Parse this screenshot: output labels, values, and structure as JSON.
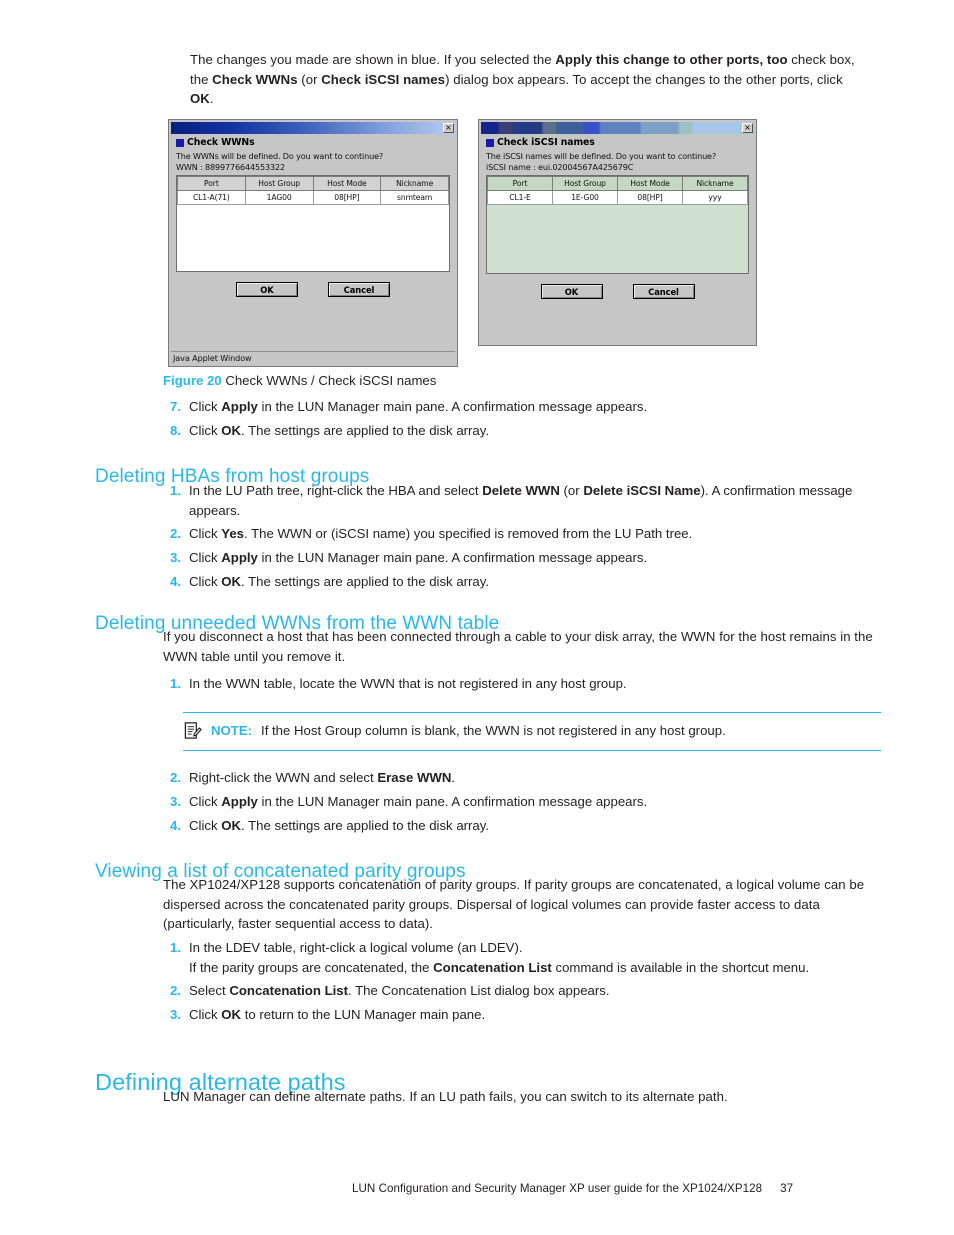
{
  "intro": {
    "line_parts": [
      {
        "t": "The changes you made are shown in blue. If you selected the ",
        "b": false
      },
      {
        "t": "Apply this change to other ports, too",
        "b": true
      },
      {
        "t": " check box, the ",
        "b": false
      },
      {
        "t": "Check WWNs",
        "b": true
      },
      {
        "t": " (or ",
        "b": false
      },
      {
        "t": "Check iSCSI names",
        "b": true
      },
      {
        "t": ") dialog box appears. To accept the changes to the other ports, click ",
        "b": false
      },
      {
        "t": "OK",
        "b": true
      },
      {
        "t": ".",
        "b": false
      }
    ]
  },
  "dialog_wwn": {
    "title": "Check WWNs",
    "close_label": "×",
    "message_line1": "The WWNs will be defined. Do you want to continue?",
    "message_line2": "WWN : 8899776644553322",
    "columns": [
      "Port",
      "Host Group",
      "Host Mode",
      "Nickname"
    ],
    "rows": [
      [
        "CL1-A(71)",
        "1AG00",
        "08[HP]",
        "snmteam"
      ]
    ],
    "ok_label": "OK",
    "cancel_label": "Cancel",
    "status_bar": "Java Applet Window"
  },
  "dialog_iscsi": {
    "title": "Check iSCSI names",
    "close_label": "×",
    "message_line1": "The iSCSI names will be defined. Do you want to continue?",
    "message_line2": "iSCSI name : eui.02004567A425679C",
    "columns": [
      "Port",
      "Host Group",
      "Host Mode",
      "Nickname"
    ],
    "rows": [
      [
        "CL1-E",
        "1E-G00",
        "08[HP]",
        "yyy"
      ]
    ],
    "ok_label": "OK",
    "cancel_label": "Cancel"
  },
  "figure": {
    "label": "Figure 20",
    "caption": "Check WWNs / Check iSCSI names"
  },
  "steps_top": [
    {
      "num": "7.",
      "parts": [
        {
          "t": "Click ",
          "b": false
        },
        {
          "t": "Apply",
          "b": true
        },
        {
          "t": " in the LUN Manager main pane. A confirmation message appears.",
          "b": false
        }
      ]
    },
    {
      "num": "8.",
      "parts": [
        {
          "t": "Click ",
          "b": false
        },
        {
          "t": "OK",
          "b": true
        },
        {
          "t": ". The settings are applied to the disk array.",
          "b": false
        }
      ]
    }
  ],
  "section_hbas": {
    "heading": "Deleting HBAs from host groups",
    "steps": [
      {
        "num": "1.",
        "parts": [
          {
            "t": "In the LU Path tree, right-click the HBA and select ",
            "b": false
          },
          {
            "t": "Delete WWN",
            "b": true
          },
          {
            "t": " (or ",
            "b": false
          },
          {
            "t": "Delete iSCSI Name",
            "b": true
          },
          {
            "t": "). A confirmation message appears.",
            "b": false
          }
        ]
      },
      {
        "num": "2.",
        "parts": [
          {
            "t": "Click ",
            "b": false
          },
          {
            "t": "Yes",
            "b": true
          },
          {
            "t": ". The WWN or (iSCSI name) you specified is removed from the LU Path tree.",
            "b": false
          }
        ]
      },
      {
        "num": "3.",
        "parts": [
          {
            "t": "Click ",
            "b": false
          },
          {
            "t": "Apply",
            "b": true
          },
          {
            "t": " in the LUN Manager main pane. A confirmation message appears.",
            "b": false
          }
        ]
      },
      {
        "num": "4.",
        "parts": [
          {
            "t": "Click ",
            "b": false
          },
          {
            "t": "OK",
            "b": true
          },
          {
            "t": ". The settings are applied to the disk array.",
            "b": false
          }
        ]
      }
    ]
  },
  "section_wwn_table": {
    "heading": "Deleting unneeded WWNs from the WWN table",
    "paragraph": "If you disconnect a host that has been connected through a cable to your disk array, the WWN for the host remains in the WWN table until you remove it.",
    "step1": {
      "num": "1.",
      "parts": [
        {
          "t": "In the WWN table, locate the WWN that is not registered in any host group.",
          "b": false
        }
      ]
    },
    "note": {
      "label": "NOTE:",
      "text": "If the Host Group column is blank, the WWN is not registered in any host group."
    },
    "steps_after": [
      {
        "num": "2.",
        "parts": [
          {
            "t": "Right-click the WWN and select ",
            "b": false
          },
          {
            "t": "Erase WWN",
            "b": true
          },
          {
            "t": ".",
            "b": false
          }
        ]
      },
      {
        "num": "3.",
        "parts": [
          {
            "t": "Click ",
            "b": false
          },
          {
            "t": "Apply",
            "b": true
          },
          {
            "t": " in the LUN Manager main pane. A confirmation message appears.",
            "b": false
          }
        ]
      },
      {
        "num": "4.",
        "parts": [
          {
            "t": "Click ",
            "b": false
          },
          {
            "t": "OK",
            "b": true
          },
          {
            "t": ". The settings are applied to the disk array.",
            "b": false
          }
        ]
      }
    ]
  },
  "section_parity": {
    "heading": "Viewing a list of concatenated parity groups",
    "paragraph": "The XP1024/XP128 supports concatenation of parity groups. If parity groups are concatenated, a logical volume can be dispersed across the concatenated parity groups. Dispersal of logical volumes can provide faster access to data (particularly, faster sequential access to data).",
    "steps": [
      {
        "num": "1.",
        "parts": [
          {
            "t": "In the LDEV table, right-click a logical volume (an LDEV).",
            "b": false
          }
        ],
        "sub_parts": [
          {
            "t": "If the parity groups are concatenated, the ",
            "b": false
          },
          {
            "t": "Concatenation List",
            "b": true
          },
          {
            "t": " command is available in the shortcut menu.",
            "b": false
          }
        ]
      },
      {
        "num": "2.",
        "parts": [
          {
            "t": "Select ",
            "b": false
          },
          {
            "t": "Concatenation List",
            "b": true
          },
          {
            "t": ". The Concatenation List dialog box appears.",
            "b": false
          }
        ]
      },
      {
        "num": "3.",
        "parts": [
          {
            "t": "Click ",
            "b": false
          },
          {
            "t": "OK",
            "b": true
          },
          {
            "t": " to return to the LUN Manager main pane.",
            "b": false
          }
        ]
      }
    ]
  },
  "section_alt_paths": {
    "heading": "Defining alternate paths",
    "paragraph": "LUN Manager can define alternate paths. If an LU path fails, you can switch to its alternate path."
  },
  "footer": {
    "text": "LUN Configuration and Security Manager XP user guide for the XP1024/XP128",
    "page_number": "37"
  },
  "colors": {
    "accent": "#29b8e8",
    "text": "#231f20",
    "dialog_face": "#c6c6c6",
    "iscsi_table_bg": "#cfe0cf"
  }
}
